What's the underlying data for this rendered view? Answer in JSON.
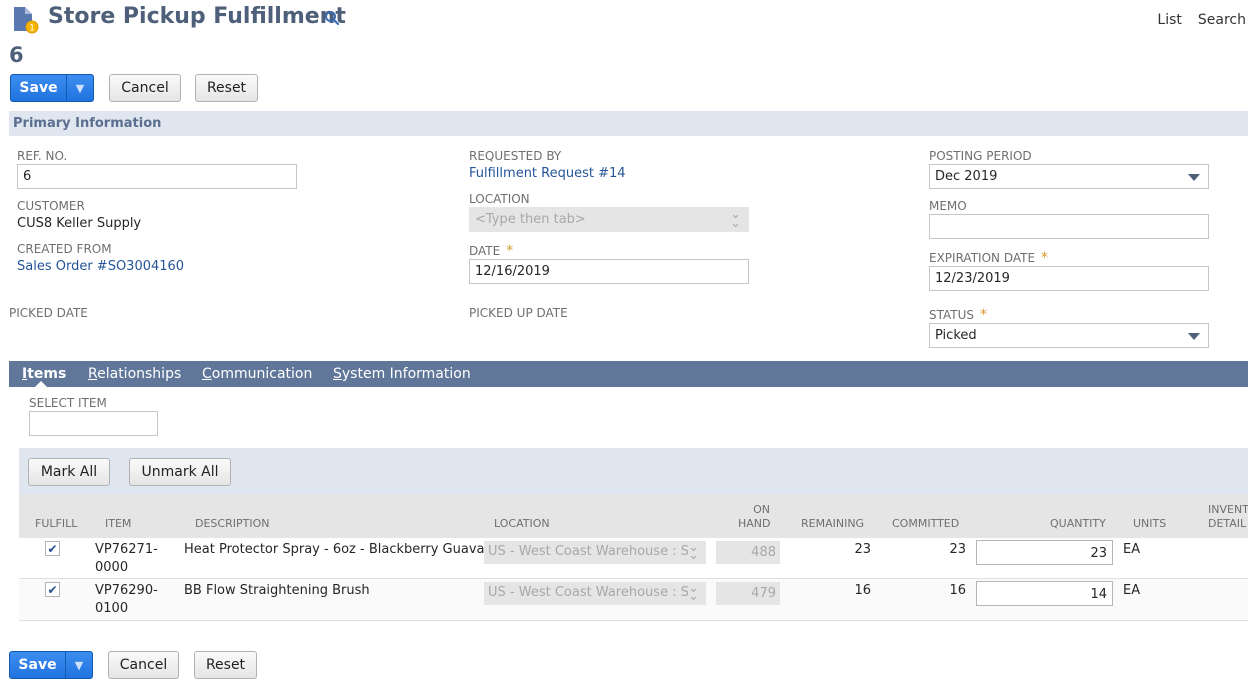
{
  "header": {
    "title": "Store Pickup Fulfillment",
    "record_number": "6",
    "links": [
      "List",
      "Search"
    ]
  },
  "buttons": {
    "save": "Save",
    "cancel": "Cancel",
    "reset": "Reset",
    "mark_all": "Mark All",
    "unmark_all": "Unmark All"
  },
  "primary": {
    "section_title": "Primary Information",
    "ref_no": {
      "label": "REF. NO.",
      "value": "6"
    },
    "customer": {
      "label": "CUSTOMER",
      "value": "CUS8 Keller Supply"
    },
    "created_from": {
      "label": "CREATED FROM",
      "value": "Sales Order #SO3004160"
    },
    "picked_date": {
      "label": "PICKED DATE"
    },
    "requested_by": {
      "label": "REQUESTED BY",
      "value": "Fulfillment Request #14"
    },
    "location": {
      "label": "LOCATION",
      "placeholder": "<Type then tab>"
    },
    "date": {
      "label": "DATE",
      "value": "12/16/2019",
      "required": "*"
    },
    "picked_up_date": {
      "label": "PICKED UP DATE"
    },
    "posting_period": {
      "label": "POSTING PERIOD",
      "value": "Dec 2019"
    },
    "memo": {
      "label": "MEMO",
      "value": ""
    },
    "expiration_date": {
      "label": "EXPIRATION DATE",
      "value": "12/23/2019",
      "required": "*"
    },
    "status": {
      "label": "STATUS",
      "value": "Picked",
      "required": "*"
    }
  },
  "tabs": [
    {
      "key": "I",
      "rest": "tems",
      "active": true
    },
    {
      "key": "R",
      "rest": "elationships"
    },
    {
      "key": "C",
      "rest": "ommunication"
    },
    {
      "key": "S",
      "rest": "ystem Information"
    }
  ],
  "items_tab": {
    "select_item_label": "SELECT ITEM",
    "columns": [
      "FULFILL",
      "ITEM",
      "DESCRIPTION",
      "LOCATION",
      "ON",
      "HAND",
      "REMAINING",
      "COMMITTED",
      "QUANTITY",
      "UNITS",
      "INVENTORY",
      "DETAIL"
    ],
    "rows": [
      {
        "fulfill": "✔",
        "item_line1": "VP76271-",
        "item_line2": "0000",
        "description": "Heat Protector Spray - 6oz - Blackberry Guava",
        "location": "US - West Coast Warehouse : S.D",
        "on_hand": "488",
        "remaining": "23",
        "committed": "23",
        "quantity": "23",
        "units": "EA"
      },
      {
        "fulfill": "✔",
        "item_line1": "VP76290-",
        "item_line2": "0100",
        "description": "BB Flow Straightening Brush",
        "location": "US - West Coast Warehouse : S.D",
        "on_hand": "479",
        "remaining": "16",
        "committed": "16",
        "quantity": "14",
        "units": "EA"
      }
    ]
  },
  "colors": {
    "accent": "#2074e0",
    "title": "#4d5f79",
    "tab_bar": "#607799",
    "section_bar": "#e0e6ef",
    "link": "#255599"
  }
}
